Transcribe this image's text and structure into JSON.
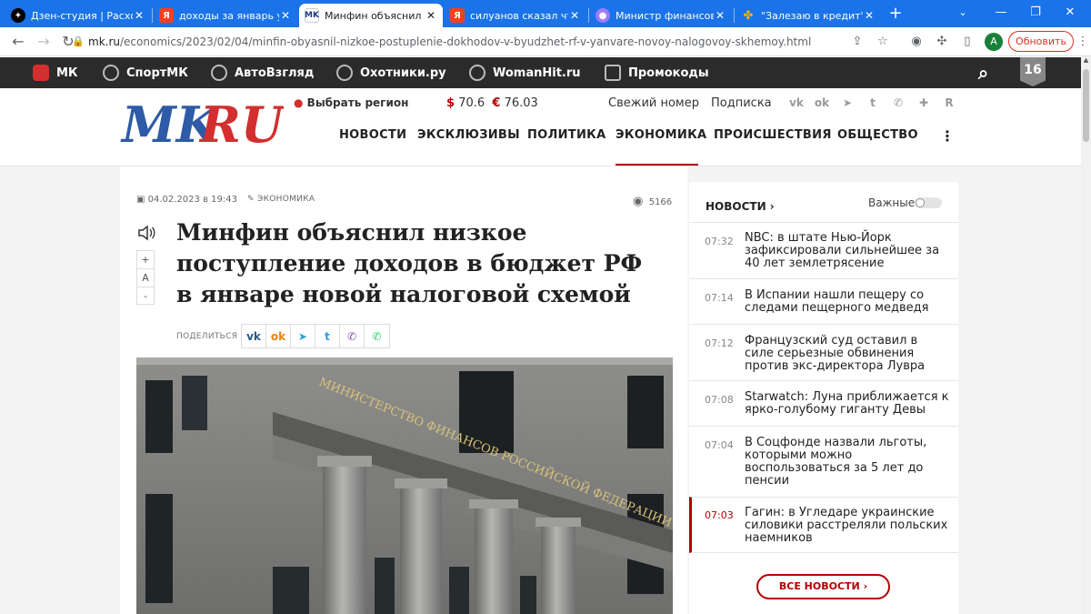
{
  "browser": {
    "tabs": [
      {
        "title": "Дзен-студия | Расходы",
        "favicon": "dzen-icon"
      },
      {
        "title": "доходы за январь упа",
        "favicon": "yandex-icon"
      },
      {
        "title": "Минфин объяснил ни",
        "favicon": "mk-icon",
        "active": true
      },
      {
        "title": "силуанов сказал что",
        "favicon": "yandex-icon"
      },
      {
        "title": "Министр финансов Р",
        "favicon": "messenger-icon"
      },
      {
        "title": "\"Залезаю в кредит\": с",
        "favicon": "pinwheel-icon"
      }
    ],
    "new_tab": "+",
    "url_host": "mk.ru",
    "url_path": "/economics/2023/02/04/minfin-obyasnil-nizkoe-postuplenie-dokhodov-v-byudzhet-rf-v-yanvare-novoy-nalogovoy-skhemoy.html",
    "avatar_letter": "A",
    "update_button": "Обновить",
    "accent": "#1a73e8"
  },
  "sitebar": {
    "items": [
      "МК",
      "СпортМК",
      "АвтоВзгляд",
      "Охотники.ру",
      "WomanHit.ru",
      "Промокоды"
    ],
    "age_badge": "16"
  },
  "header": {
    "logo_mk": "MK",
    "logo_ru": "RU",
    "region": "Выбрать регион",
    "usd_symbol": "$",
    "usd": "70.6",
    "eur_symbol": "€",
    "eur": "76.03",
    "fresh_issue": "Свежий номер",
    "subscription": "Подписка",
    "menu": [
      "НОВОСТИ",
      "ЭКСКЛЮЗИВЫ",
      "ПОЛИТИКА",
      "ЭКОНОМИКА",
      "ПРОИСШЕСТВИЯ",
      "ОБЩЕСТВО"
    ],
    "active_menu": "ЭКОНОМИКА",
    "brand_red": "#b30000"
  },
  "article": {
    "date": "04.02.2023 в 19:43",
    "category": "ЭКОНОМИКА",
    "views": "5166",
    "font_plus": "+",
    "font_a": "A",
    "font_minus": "-",
    "title": "Минфин объяснил низкое поступление доходов в бюджет РФ в январе новой налоговой схемой",
    "share_label": "ПОДЕЛИТЬСЯ",
    "building_sign": "МИНИСТЕРСТВО ФИНАНСОВ РОССИЙСКОЙ ФЕДЕРАЦИИ"
  },
  "sidebar": {
    "title": "НОВОСТИ ›",
    "toggle_label": "Важные",
    "news": [
      {
        "time": "07:32",
        "text": "NBC: в штате Нью-Йорк зафиксировали сильнейшее за 40 лет землетрясение"
      },
      {
        "time": "07:14",
        "text": "В Испании нашли пещеру со следами пещерного медведя"
      },
      {
        "time": "07:12",
        "text": "Французский суд оставил в силе серьезные обвинения против экс-директора Лувра"
      },
      {
        "time": "07:08",
        "text": "Starwatch: Луна приближается к ярко-голубому гиганту Девы"
      },
      {
        "time": "07:04",
        "text": "В Соцфонде назвали льготы, которыми можно воспользоваться за 5 лет до пенсии"
      },
      {
        "time": "07:03",
        "text": "Гагин: в Угледаре украинские силовики расстреляли польских наемников",
        "highlighted": true
      }
    ],
    "all_news": "ВСЕ НОВОСТИ ›"
  }
}
